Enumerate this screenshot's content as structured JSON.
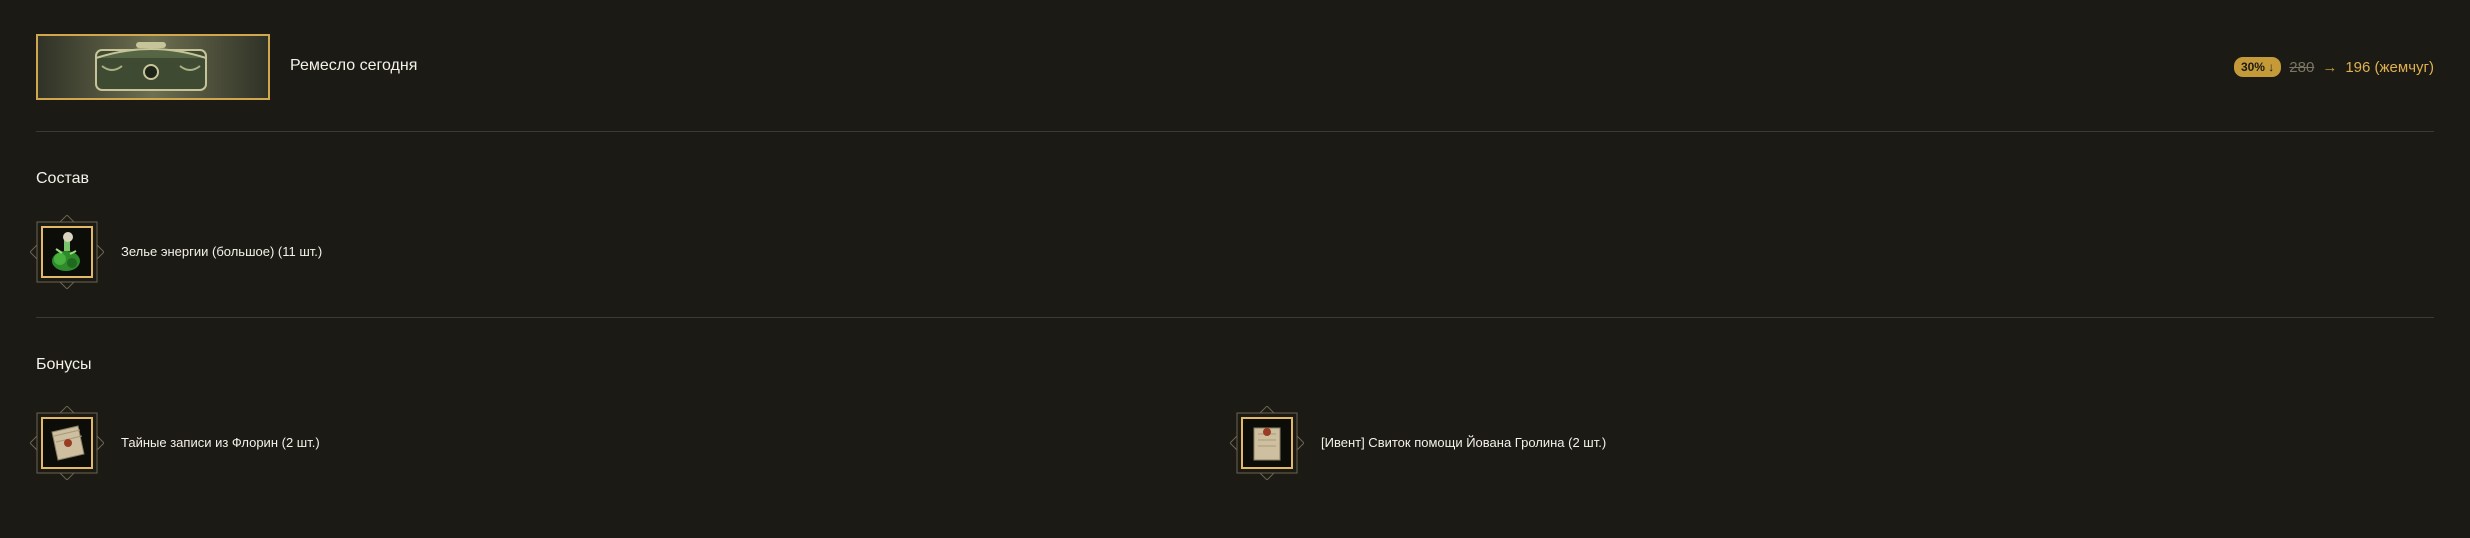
{
  "product": {
    "title": "Ремесло сегодня",
    "discount_badge": "30% ↓",
    "old_price": "280",
    "arrow": "→",
    "new_price": "196 (жемчуг)"
  },
  "composition": {
    "title": "Состав",
    "items": [
      {
        "label": "Зелье энергии (большое) (11 шт.)",
        "icon": "green-potion-icon"
      }
    ]
  },
  "bonuses": {
    "title": "Бонусы",
    "items": [
      {
        "label": "Тайные записи из Флорин (2 шт.)",
        "icon": "sealed-letter-icon"
      },
      {
        "label": "[Ивент] Свиток помощи Йована Гролина (2 шт.)",
        "icon": "sealed-letter-icon"
      }
    ]
  },
  "colors": {
    "background": "#1b1a14",
    "accent_gold": "#c59a38",
    "divider": "#3d3b30",
    "text": "#f4f1e8"
  }
}
